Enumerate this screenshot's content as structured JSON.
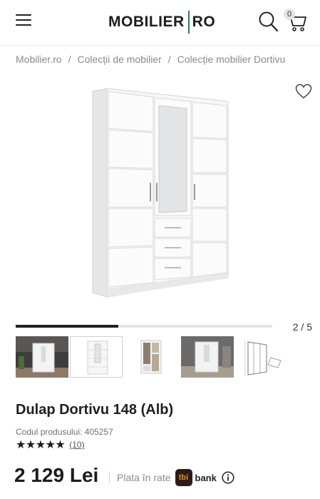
{
  "header": {
    "logo_left": "MOBILIER",
    "logo_right": "RO",
    "cart_count": "0",
    "icons": [
      "menu-icon",
      "search-icon",
      "cart-icon"
    ]
  },
  "breadcrumb": {
    "items": [
      "Mobilier.ro",
      "Colecții de mobilier",
      "Colecție mobilier Dortivu"
    ],
    "separator": "/"
  },
  "gallery": {
    "counter": "2 / 5",
    "current": 2,
    "total": 5,
    "progress_fraction": 0.4,
    "thumbnails": [
      "room-scene-1",
      "wardrobe-front",
      "wardrobe-interior",
      "room-scene-2",
      "dimensions-drawing"
    ]
  },
  "product": {
    "title": "Dulap Dortivu 148 (Alb)",
    "code_label": "Codul produsului: 405257",
    "stars": "★★★★★",
    "rating_value": 5,
    "review_count": "(10)",
    "price": "2 129 Lei",
    "installment_label": "Plata în rate",
    "tbi_logo": "tbi",
    "bank_label": "bank"
  },
  "colors": {
    "accent": "#2f7a4a",
    "text": "#1c1c1c",
    "muted": "#8a8a8a",
    "tbi_bg": "#2b1d15",
    "tbi_text": "#f58a1f"
  }
}
